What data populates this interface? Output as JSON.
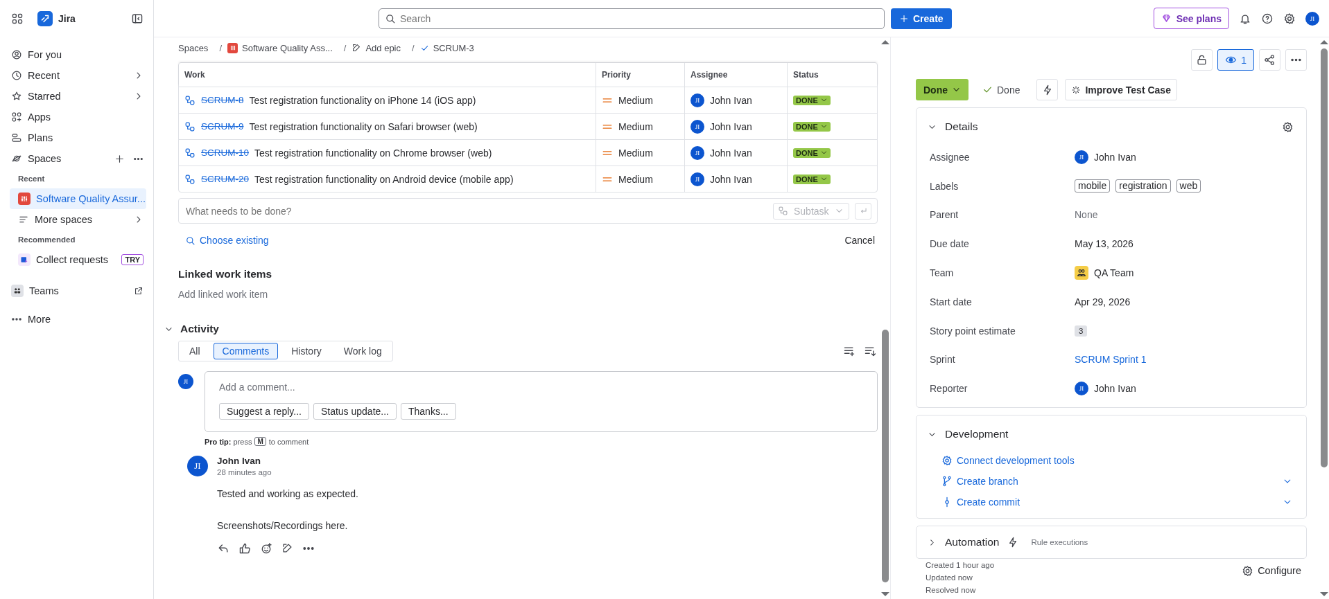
{
  "sidebar": {
    "app_name": "Jira",
    "items": [
      {
        "kind": "nav",
        "label": "For you",
        "selected": false,
        "expandable": false
      },
      {
        "kind": "nav",
        "label": "Recent",
        "selected": false,
        "expandable": true
      },
      {
        "kind": "nav",
        "label": "Starred",
        "selected": false,
        "expandable": true
      },
      {
        "kind": "nav",
        "label": "Apps",
        "selected": false,
        "expandable": false
      },
      {
        "kind": "nav",
        "label": "Plans",
        "selected": false,
        "expandable": false
      },
      {
        "kind": "spaces",
        "label": "Spaces",
        "selected": false,
        "expandable": false
      },
      {
        "kind": "heading",
        "label": "Recent"
      },
      {
        "kind": "space",
        "label": "Software Quality Assur...",
        "selected": true,
        "expandable": false
      },
      {
        "kind": "nav",
        "label": "More spaces",
        "selected": false,
        "expandable": true
      },
      {
        "kind": "heading",
        "label": "Recommended"
      },
      {
        "kind": "promo",
        "label": "Collect requests",
        "badge": "TRY",
        "selected": false,
        "expandable": false
      },
      {
        "kind": "external",
        "label": "Teams",
        "selected": false,
        "expandable": false
      },
      {
        "kind": "more",
        "label": "More",
        "selected": false,
        "expandable": false
      }
    ]
  },
  "topbar": {
    "search": {
      "placeholder": "Search"
    },
    "create": "Create",
    "plans": "See plans",
    "avatar": "JI"
  },
  "breadcrumbs": [
    {
      "label": "Spaces",
      "separator": "/"
    },
    {
      "label": "Software Quality Ass...",
      "separator": "/"
    },
    {
      "label": "Add epic",
      "separator": "/"
    },
    {
      "label": "SCRUM-3"
    }
  ],
  "table": {
    "columns": [
      "Work",
      "Priority",
      "Assignee",
      "Status"
    ],
    "rows": [
      {
        "key": "SCRUM-8",
        "summary": "Test registration functionality on iPhone 14 (iOS app)",
        "done": true,
        "priority": "Medium",
        "assignee": {
          "initials": "JI",
          "name": "John Ivan"
        },
        "status": "DONE"
      },
      {
        "key": "SCRUM-9",
        "summary": "Test registration functionality on Safari browser (web)",
        "done": true,
        "priority": "Medium",
        "assignee": {
          "initials": "JI",
          "name": "John Ivan"
        },
        "status": "DONE"
      },
      {
        "key": "SCRUM-10",
        "summary": "Test registration functionality on Chrome browser (web)",
        "done": true,
        "priority": "Medium",
        "assignee": {
          "initials": "JI",
          "name": "John Ivan"
        },
        "status": "DONE"
      },
      {
        "key": "SCRUM-20",
        "summary": "Test registration functionality on Android device (mobile app)",
        "done": true,
        "priority": "Medium",
        "assignee": {
          "initials": "JI",
          "name": "John Ivan"
        },
        "status": "DONE"
      }
    ]
  },
  "new_subtask": {
    "placeholder": "What needs to be done?",
    "type": "Subtask",
    "disabled": true
  },
  "choose_existing": "Choose existing",
  "cancel": "Cancel",
  "linked": {
    "title": "Linked work items",
    "add": "Add linked work item"
  },
  "activity": {
    "title": "Activity",
    "expanded": true,
    "tabs": [
      {
        "label": "All",
        "selected": false
      },
      {
        "label": "Comments",
        "selected": true
      },
      {
        "label": "History",
        "selected": false
      },
      {
        "label": "Work log",
        "selected": false
      }
    ],
    "composer": {
      "avatar": "JI",
      "placeholder": "Add a comment...",
      "suggestions": [
        "Suggest a reply...",
        "Status update...",
        "Thanks..."
      ]
    },
    "pro_tip": {
      "before": "**Pro tip:** press",
      "key": "M",
      "after": "to comment"
    },
    "comments": [
      {
        "avatar": "JI",
        "author": "John Ivan",
        "time": "28 minutes ago",
        "paragraphs": [
          "Tested and working as expected.",
          "Screenshots/Recordings here."
        ]
      }
    ]
  },
  "panel": {
    "watchers": "1",
    "status": "Done",
    "resolution": "Done",
    "improve": "Improve Test Case",
    "details": {
      "title": "Details",
      "expanded": true,
      "fields": [
        {
          "kind": "user",
          "label": "Assignee",
          "initials": "JI",
          "value": "John Ivan"
        },
        {
          "kind": "labels",
          "label": "Labels",
          "values": [
            "mobile",
            "registration",
            "web"
          ]
        },
        {
          "kind": "muted",
          "label": "Parent",
          "value": "None"
        },
        {
          "kind": "text",
          "label": "Due date",
          "value": "May 13, 2026"
        },
        {
          "kind": "team",
          "label": "Team",
          "value": "QA Team"
        },
        {
          "kind": "text",
          "label": "Start date",
          "value": "Apr 29, 2026"
        },
        {
          "kind": "badge",
          "label": "Story point estimate",
          "value": "3"
        },
        {
          "kind": "link",
          "label": "Sprint",
          "value": "SCRUM Sprint 1"
        },
        {
          "kind": "user",
          "label": "Reporter",
          "initials": "JI",
          "value": "John Ivan"
        }
      ]
    },
    "development": {
      "title": "Development",
      "expanded": true,
      "actions": [
        {
          "label": "Connect development tools",
          "expandable": false
        },
        {
          "label": "Create branch",
          "expandable": true
        },
        {
          "label": "Create commit",
          "expandable": true
        }
      ]
    },
    "automation": {
      "title": "Automation",
      "expanded": false,
      "subtitle": "Rule executions"
    },
    "dates": [
      "Created 1 hour ago",
      "Updated now",
      "Resolved now"
    ],
    "configure": "Configure"
  }
}
